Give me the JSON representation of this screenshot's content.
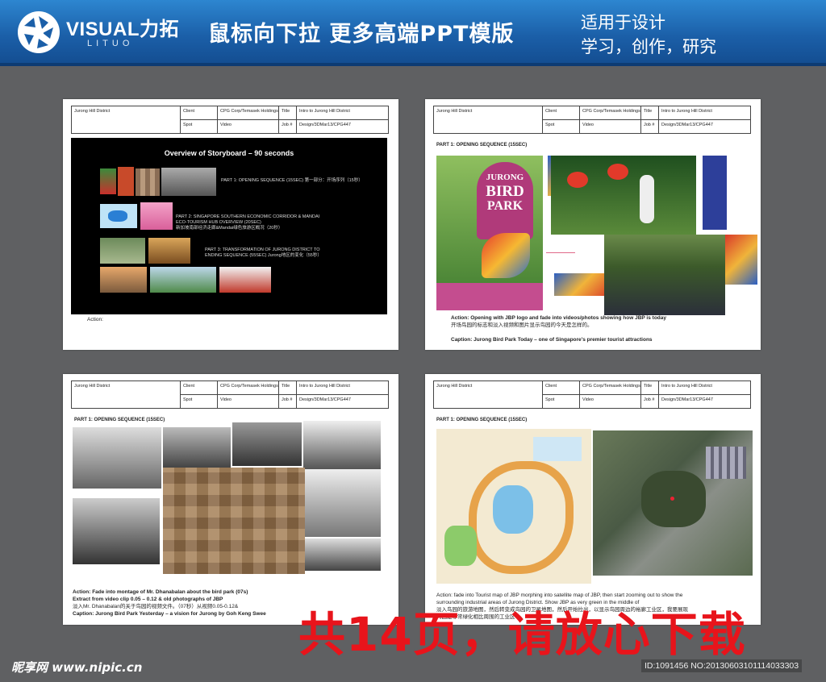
{
  "banner": {
    "brand": "VISUAL力拓",
    "brand_sub": "LITUO",
    "headline": "鼠标向下拉 更多高端PPT模版",
    "slogan_line1": "适用于设计",
    "slogan_line2": "学习，创作，研究"
  },
  "header": {
    "project": "Jurong Hill District",
    "client_label": "Client",
    "client_value": "CPG Corp/Temasek Holdings",
    "title_label": "Title",
    "title_value": "Intro to Jurong Hill District",
    "spot_label": "Spot",
    "spot_value": "Video",
    "job_label": "Job #",
    "job_value": "Design/3DMar13/CPG447"
  },
  "slide1": {
    "title": "Overview of Storyboard – 90 seconds",
    "part1": "PART 1: OPENING SEQUENCE (15SEC) 第一部分：开场序列（15秒）",
    "part2_l1": "PART 2: SINGAPORE SOUTHERN ECONOMIC CORRIDOR & MANDAI",
    "part2_l2": "ECO-TOURISM HUB OVERVIEW (20SEC)",
    "part2_l3": "新加坡南部经济走廊&Mandai绿色旅游区概况（20秒）",
    "part3_l1": "PART 3: TRANSFORMATION OF JURONG DISTRICT TO",
    "part3_l2": "ENDING SEQUENCE  (55SEC) Jurong地区的变化（55秒）",
    "action": "Action:"
  },
  "slide2": {
    "part": "PART 1: OPENING SEQUENCE (15SEC)",
    "sign_l1": "JURONG",
    "sign_l2": "BIRD",
    "sign_l3": "PARK",
    "action": "Action: Opening with JBP logo and fade into videos/photos showing how JBP is today",
    "action_cn": "开场鸟园的标志和淡入视频和图片显示鸟园的今天是怎样的。",
    "caption": "Caption: Jurong Bird Park Today – one of Singapore's premier tourist attractions"
  },
  "slide3": {
    "part": "PART 1: OPENING SEQUENCE (15SEC)",
    "line1": "Action: Fade into montage of Mr. Dhanabalan about the bird park (07s)",
    "line2": "Extract from video clip 0.05 – 0.12 & old photographs of JBP",
    "line3": "淡入Mr. Dhanabalan的关于鸟园的视频文件。（07秒）从视频0.05-0.12&",
    "line4": "Caption: Jurong Bird Park Yesterday – a vision for Jurong by Goh Keng Swee"
  },
  "slide4": {
    "part": "PART 1: OPENING SEQUENCE (15SEC)",
    "line1": "Action: fade into Tourist map of JBP morphing into satellite map of JBP, then start zooming out to show the",
    "line2": "surrounding industrial areas of Jurong District. Show JBP as very green in the middle of",
    "line3": "淡入鸟园的旅游地图，然后转变成鸟园的卫星地图，然后开始拉出，以显示鸟园周边的裕廊工业区，我要展现",
    "line4": "鸟园是非常绿化相比周围的工业区"
  },
  "overlay": {
    "big_text": "共14页，请放心下载",
    "watermark": "昵享网 www.nipic.cn",
    "id_text": "ID:1091456 NO:20130603101114033303"
  },
  "colors": {
    "banner": "#1b5fa8",
    "background": "#5f6062",
    "big_text": "#e8141b"
  }
}
